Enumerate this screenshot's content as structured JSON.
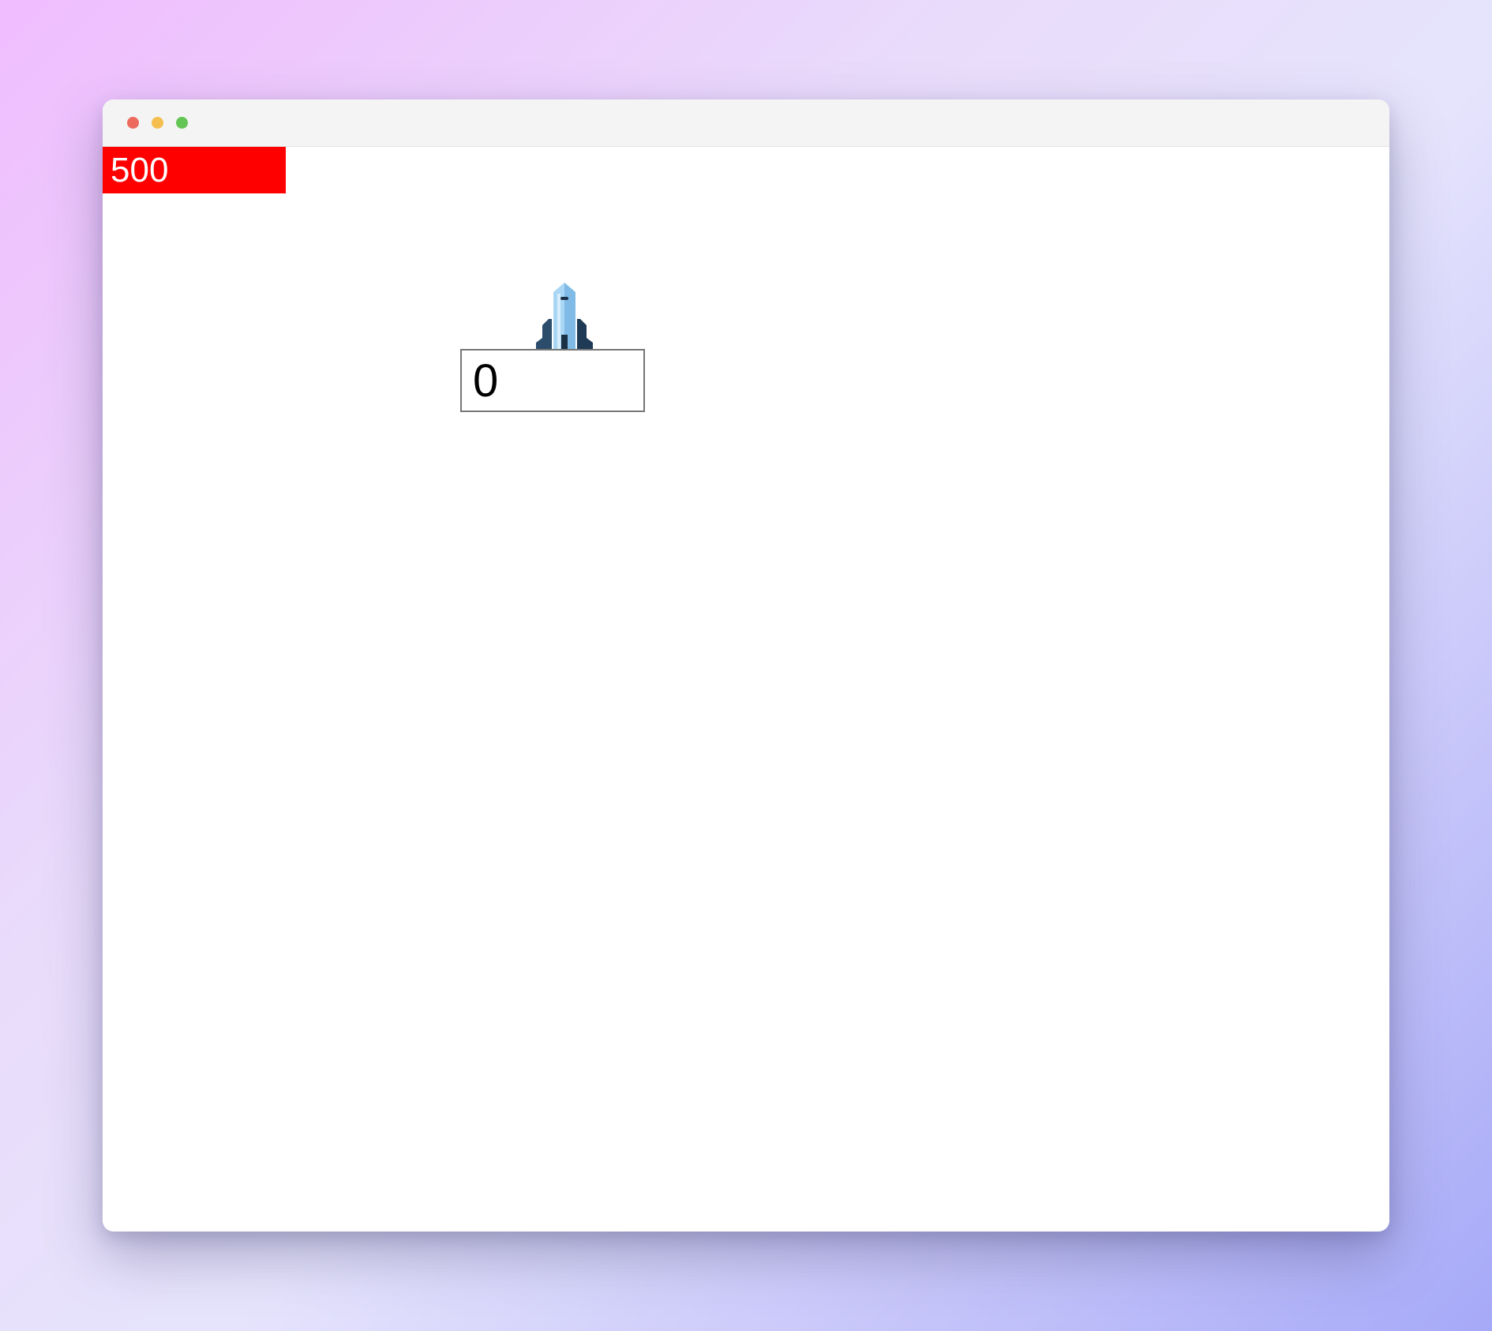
{
  "window": {
    "controls": [
      "close",
      "minimize",
      "maximize"
    ]
  },
  "game": {
    "score": "500",
    "score_color": "#ff0000",
    "input_value": "0",
    "player_icon": "rocket-ship-icon"
  }
}
